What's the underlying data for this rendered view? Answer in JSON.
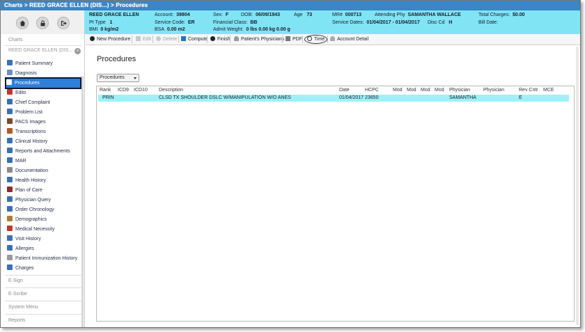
{
  "titlebar": {
    "text": "Charts > REED GRACE ELLEN (DIS...) > Procedures"
  },
  "patient": {
    "name": "REED GRACE ELLEN",
    "pt_type_label": "Pt Type",
    "pt_type": "1",
    "bmi_label": "BMI",
    "bmi": "0 kg/m2",
    "account_label": "Account:",
    "account": "39804",
    "service_code_label": "Service Code:",
    "service_code": "ER",
    "bsa_label": "BSA",
    "bsa": "0.00 m2",
    "sex_label": "Sex:",
    "sex": "F",
    "dob_label": "DOB:",
    "dob": "06/09/1943",
    "age_label": "Age",
    "age": "73",
    "financial_class_label": "Financial Class:",
    "financial_class": "BB",
    "admit_weight_label": "Admit Weight:",
    "admit_weight": "0 lbs 0.00 kg 0.00 g",
    "mr_label": "MR#",
    "mr": "000713",
    "attending_label": "Attending Phy",
    "attending": "SAMANTHA WALLACE",
    "service_dates_label": "Service Dates:",
    "service_dates": "01/04/2017 - 01/04/2017",
    "disc_cd_label": "Disc Cd",
    "disc_cd": "H",
    "total_charges_label": "Total Charges:",
    "total_charges": "$0.00",
    "bill_date_label": "Bill Date:"
  },
  "sidebar": {
    "charts_label": "Charts",
    "patient_label": "REED GRACE ELLEN (DIS...",
    "items": [
      {
        "label": "Patient Summary",
        "icon": "patient-summary-icon",
        "color": "#3b6fb5"
      },
      {
        "label": "Diagnosis",
        "icon": "diagnosis-icon",
        "color": "#6a8fc7"
      },
      {
        "label": "Procedures",
        "icon": "procedures-icon",
        "color": "#ffffff"
      },
      {
        "label": "Edits",
        "icon": "edits-icon",
        "color": "#c0392b"
      },
      {
        "label": "Chief Complaint",
        "icon": "chief-complaint-icon",
        "color": "#3b6fb5"
      },
      {
        "label": "Problem List",
        "icon": "problem-list-icon",
        "color": "#3b6fb5"
      },
      {
        "label": "PACS Images",
        "icon": "pacs-images-icon",
        "color": "#7a4a2a"
      },
      {
        "label": "Transcriptions",
        "icon": "transcriptions-icon",
        "color": "#b05a2a"
      },
      {
        "label": "Clinical History",
        "icon": "clinical-history-icon",
        "color": "#3b6fb5"
      },
      {
        "label": "Reports and Attachments",
        "icon": "reports-icon",
        "color": "#3b6fb5"
      },
      {
        "label": "MAR",
        "icon": "mar-icon",
        "color": "#3b6fb5"
      },
      {
        "label": "Documentation",
        "icon": "documentation-icon",
        "color": "#8a8a8a"
      },
      {
        "label": "Health History",
        "icon": "health-history-icon",
        "color": "#3b6fb5"
      },
      {
        "label": "Plan of Care",
        "icon": "plan-of-care-icon",
        "color": "#8b2a2a"
      },
      {
        "label": "Physician Query",
        "icon": "physician-query-icon",
        "color": "#3b6fb5"
      },
      {
        "label": "Order Chronology",
        "icon": "order-chronology-icon",
        "color": "#3b6fb5"
      },
      {
        "label": "Demographics",
        "icon": "demographics-icon",
        "color": "#b07a3a"
      },
      {
        "label": "Medical Necessity",
        "icon": "medical-necessity-icon",
        "color": "#c0392b"
      },
      {
        "label": "Visit History",
        "icon": "visit-history-icon",
        "color": "#3b6fb5"
      },
      {
        "label": "Allergies",
        "icon": "allergies-icon",
        "color": "#3b6fb5"
      },
      {
        "label": "Patient Immunization History",
        "icon": "immunization-icon",
        "color": "#999999"
      },
      {
        "label": "Charges",
        "icon": "charges-icon",
        "color": "#3b6fb5"
      }
    ],
    "sections": [
      "E-Sign",
      "E-Scribe",
      "System Menu",
      "Reports"
    ]
  },
  "toolbar": {
    "new_procedure": "New Procedure",
    "edit": "Edit",
    "delete": "Delete",
    "compute": "Compute",
    "finish": "Finish",
    "patients_physicians": "Patient's Physicians",
    "pdf": "PDF",
    "time": "Time",
    "account_detail": "Account Detail"
  },
  "main": {
    "title": "Procedures",
    "filter_value": "Procedures",
    "columns": [
      "Rank",
      "ICD9",
      "ICD10",
      "Description",
      "Date",
      "HCPC",
      "Mod",
      "Mod",
      "Mod",
      "Mod",
      "Physician",
      "Physician",
      "Rev Cntr",
      "MCE"
    ],
    "rows": [
      {
        "rank": "PRIN",
        "icd9": "",
        "icd10": "",
        "description": "CLSD TX SHOULDER DSLC W/MANIPULATION W/O ANES",
        "date": "01/04/2017",
        "hcpc": "23650",
        "physician": "SAMANTHA",
        "rev_cntr": "E"
      }
    ]
  }
}
